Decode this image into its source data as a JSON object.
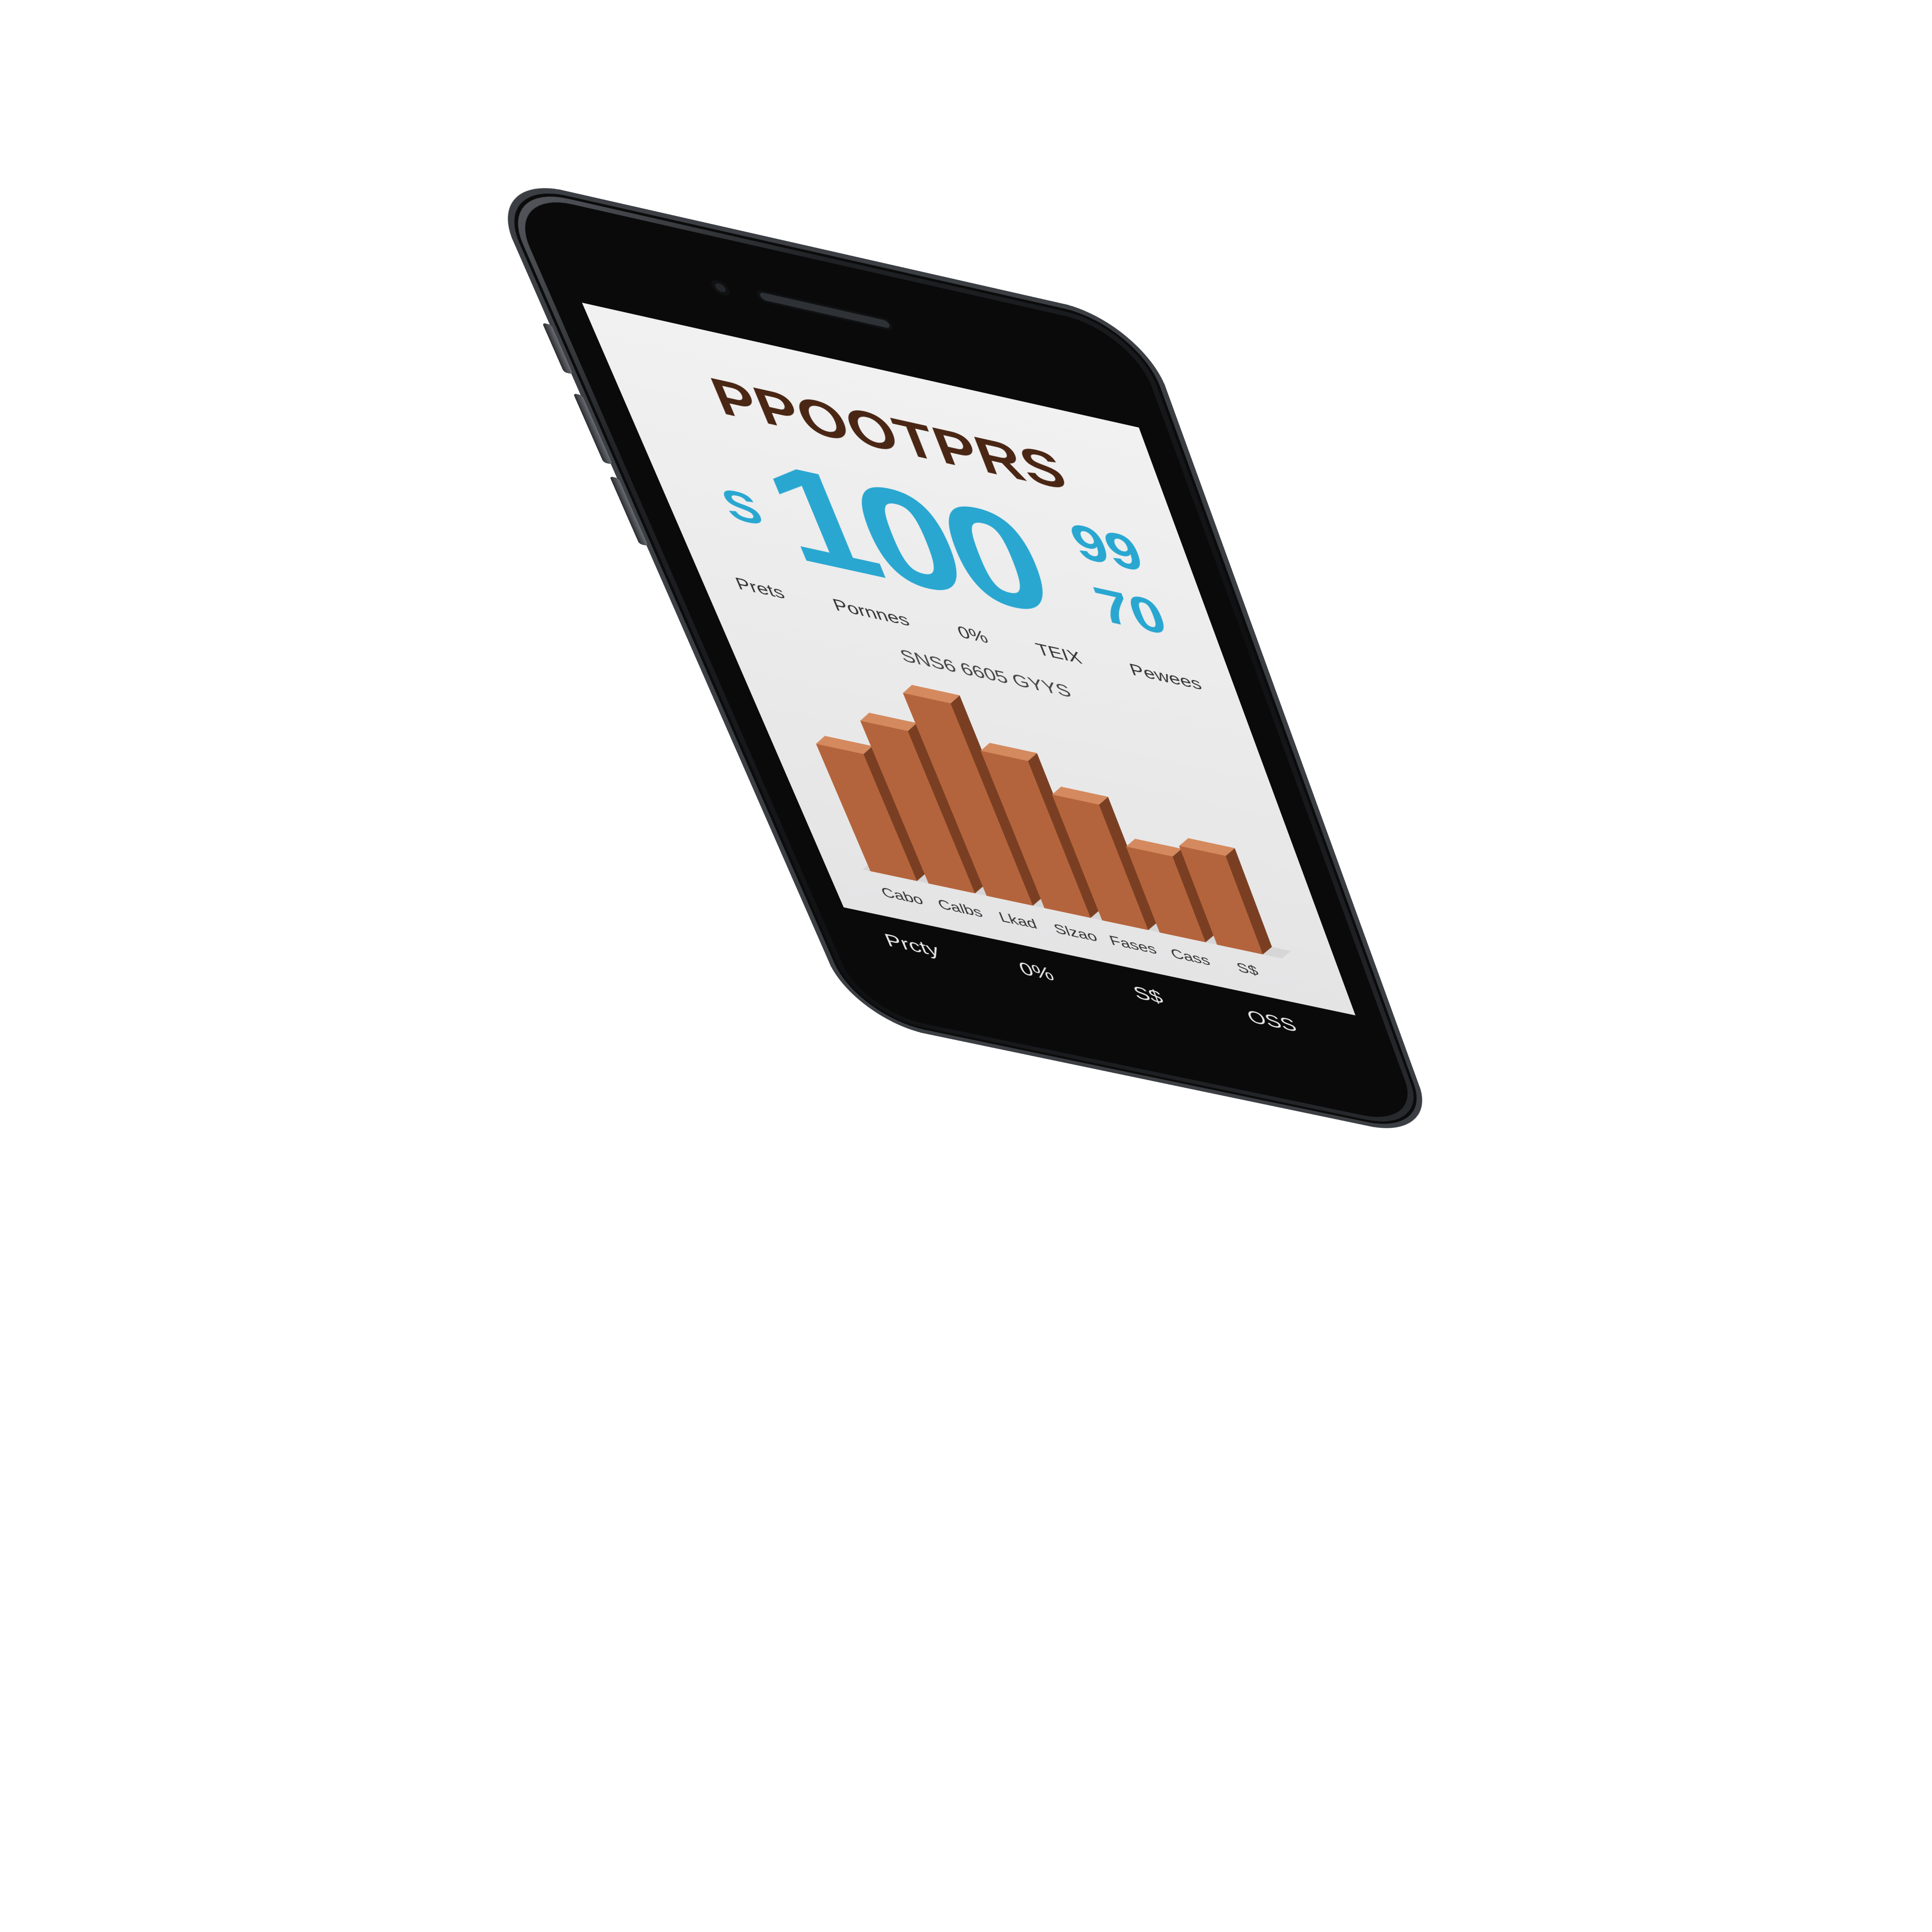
{
  "screen": {
    "title": "PPOOTPRS",
    "currency_symbol": "S",
    "big_value": "100",
    "superscript": "99",
    "subscript": "70",
    "stats": [
      "Prets",
      "Pornnes",
      "0%",
      "TEIX",
      "Pewees"
    ],
    "subtitle": "SNS6 6605 GYYS"
  },
  "bottom_bar": {
    "labels": [
      "Prcty",
      "0%",
      "S$",
      "OSS"
    ]
  },
  "chart_data": {
    "type": "bar",
    "categories": [
      "Cabo",
      "Calbs",
      "Lkad",
      "Slzao",
      "Fases",
      "Cass",
      "S$"
    ],
    "values": [
      58,
      74,
      92,
      72,
      58,
      40,
      46
    ],
    "ylim": [
      0,
      100
    ],
    "title": "",
    "xlabel": "",
    "ylabel": "",
    "grid": false,
    "colors": {
      "front": "#b4643c",
      "side": "#7a3f22",
      "top": "#d48a5e"
    }
  }
}
